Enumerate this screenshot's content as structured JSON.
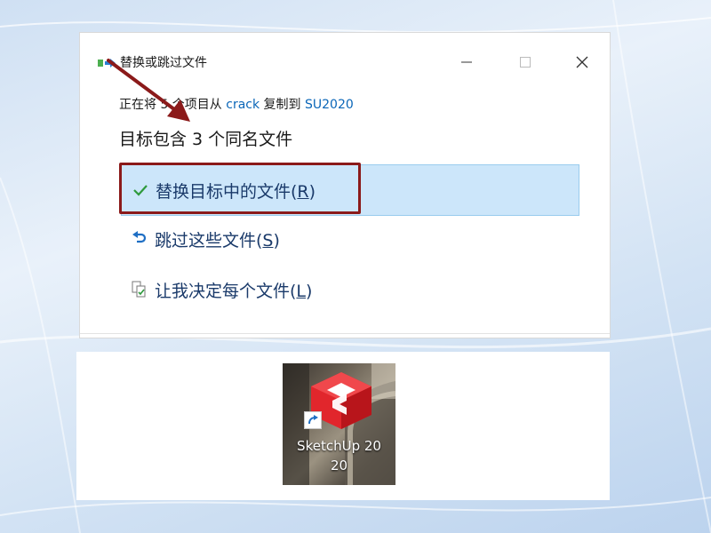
{
  "dialog": {
    "title": "替换或跳过文件",
    "status": {
      "prefix": "正在将 5 个项目从 ",
      "source": "crack",
      "middle": " 复制到 ",
      "destination": "SU2020"
    },
    "heading": "目标包含 3 个同名文件",
    "options": [
      {
        "label": "替换目标中的文件(",
        "key": "R",
        "suffix": ")",
        "icon": "checkmark-icon"
      },
      {
        "label": "跳过这些文件(",
        "key": "S",
        "suffix": ")",
        "icon": "undo-arrow-icon"
      },
      {
        "label": "让我决定每个文件(",
        "key": "L",
        "suffix": ")",
        "icon": "compare-files-icon"
      }
    ]
  },
  "desktop_icon": {
    "caption_line1": "SketchUp 20",
    "caption_line2": "20"
  },
  "colors": {
    "link": "#0a66b8",
    "selected_option_bg": "#cce6fa",
    "annotation_red": "#8b1a1a",
    "sketchup_red": "#e1262c"
  }
}
